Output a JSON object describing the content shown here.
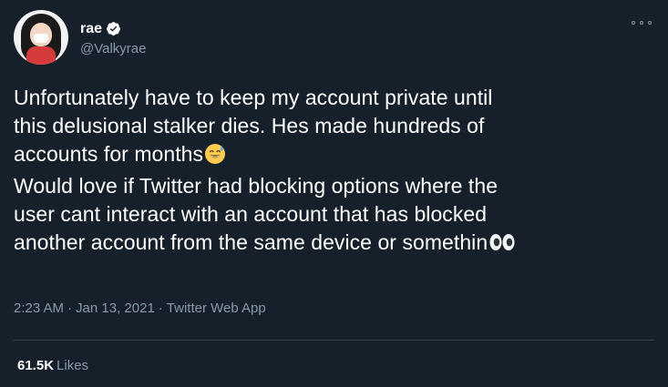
{
  "user": {
    "display_name": "rae",
    "handle": "@Valkyrae",
    "verified": true
  },
  "tweet": {
    "lines": [
      "Unfortunately have to keep my account private until",
      "this delusional stalker dies. Hes made hundreds of",
      "accounts for months",
      "Would love if Twitter had blocking options where the",
      "user cant interact with an account that has blocked",
      "another account from the same device or somethin"
    ],
    "emoji_1": "grinning-face-with-sweat",
    "emoji_2": "eyes"
  },
  "meta": {
    "time": "2:23 AM",
    "separator": "·",
    "date": "Jan 13, 2021",
    "source": "Twitter Web App"
  },
  "stats": {
    "likes_count": "61.5K",
    "likes_label": "Likes"
  },
  "colors": {
    "background": "#15202b",
    "text": "#ffffff",
    "secondary": "#8899a6",
    "verified": "#ffffff",
    "divider": "#38444d"
  }
}
